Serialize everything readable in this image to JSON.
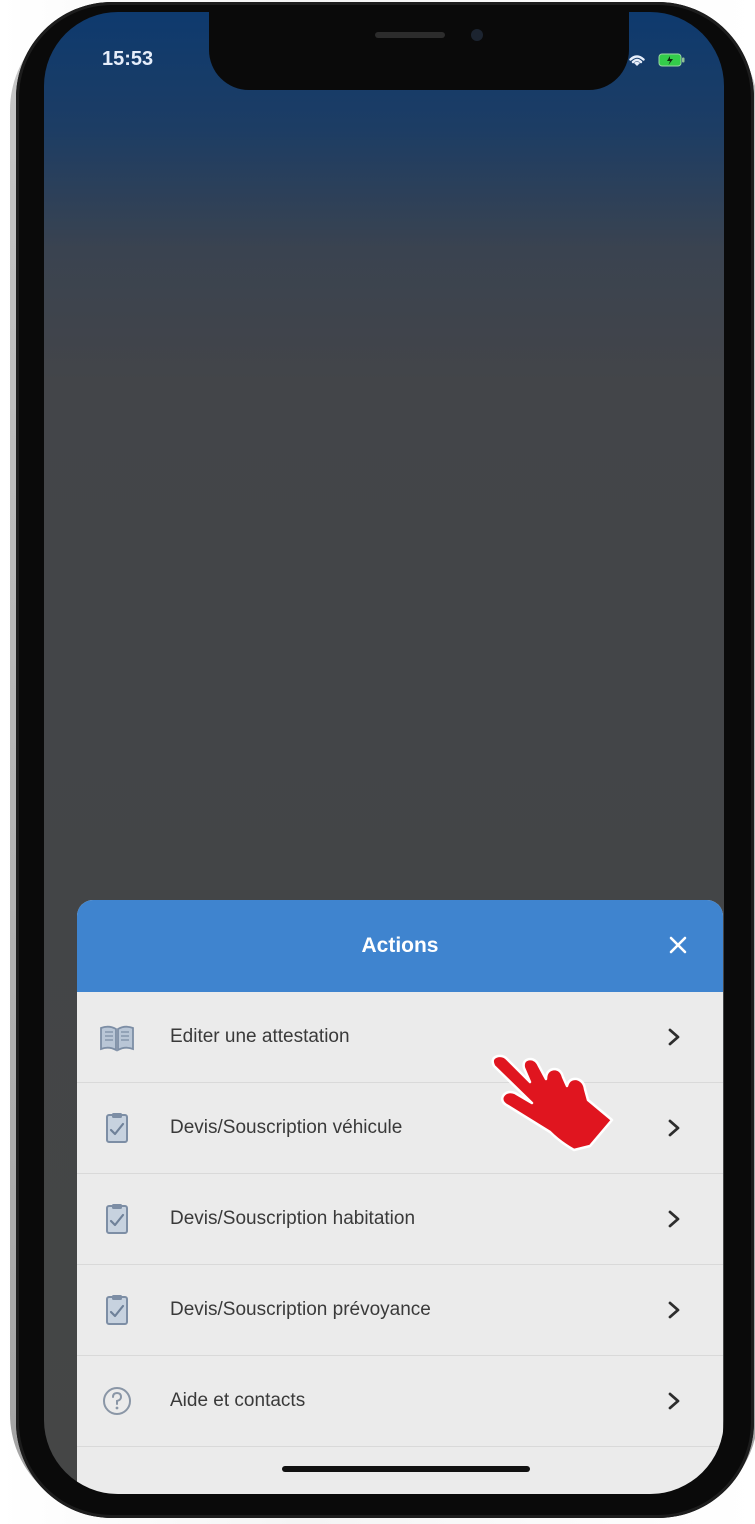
{
  "status_bar": {
    "time": "15:53"
  },
  "sheet": {
    "title": "Actions",
    "close_icon": "close-icon",
    "items": [
      {
        "label": "Editer une attestation",
        "icon": "book-icon"
      },
      {
        "label": "Devis/Souscription véhicule",
        "icon": "clipboard-check-icon"
      },
      {
        "label": "Devis/Souscription habitation",
        "icon": "clipboard-check-icon"
      },
      {
        "label": "Devis/Souscription prévoyance",
        "icon": "clipboard-check-icon"
      },
      {
        "label": "Aide et contacts",
        "icon": "help-circle-icon"
      }
    ]
  },
  "colors": {
    "header_blue": "#3f84cf",
    "sheet_bg": "#ebebeb",
    "hand_red": "#e0151f"
  },
  "overlay": {
    "pointer": "pointing-hand-icon"
  }
}
